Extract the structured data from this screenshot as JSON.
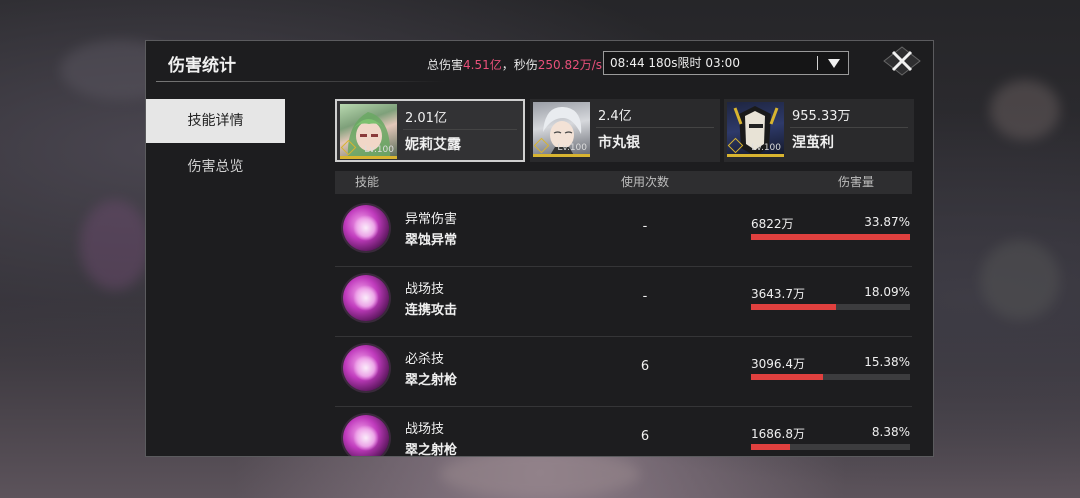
{
  "title": "伤害统计",
  "summary": {
    "total_label": "总伤害",
    "total_value": "4.51亿",
    "dps_label": "，秒伤",
    "dps_value": "250.82万/s"
  },
  "time_select": {
    "value": "08:44 180s限时 03:00"
  },
  "sidebar": {
    "items": [
      {
        "label": "技能详情",
        "active": true
      },
      {
        "label": "伤害总览",
        "active": false
      }
    ]
  },
  "characters": [
    {
      "damage": "2.01亿",
      "name": "妮莉艾露",
      "level": "Lv.100",
      "selected": true
    },
    {
      "damage": "2.4亿",
      "name": "市丸银",
      "level": "Lv.100",
      "selected": false
    },
    {
      "damage": "955.33万",
      "name": "涅茧利",
      "level": "Lv.100",
      "selected": false
    }
  ],
  "table": {
    "headers": {
      "skill": "技能",
      "uses": "使用次数",
      "damage": "伤害量"
    },
    "rows": [
      {
        "type": "异常伤害",
        "name": "翠蚀异常",
        "uses": "-",
        "damage": "6822万",
        "percent": "33.87%",
        "ratio": 1.0
      },
      {
        "type": "战场技",
        "name": "连携攻击",
        "uses": "-",
        "damage": "3643.7万",
        "percent": "18.09%",
        "ratio": 0.534
      },
      {
        "type": "必杀技",
        "name": "翠之射枪",
        "uses": "6",
        "damage": "3096.4万",
        "percent": "15.38%",
        "ratio": 0.454
      },
      {
        "type": "战场技",
        "name": "翠之射枪",
        "uses": "6",
        "damage": "1686.8万",
        "percent": "8.38%",
        "ratio": 0.247
      }
    ]
  },
  "colors": {
    "accent": "#e8507a",
    "bar": "#e0403e",
    "level_bar": "#d8b430"
  }
}
